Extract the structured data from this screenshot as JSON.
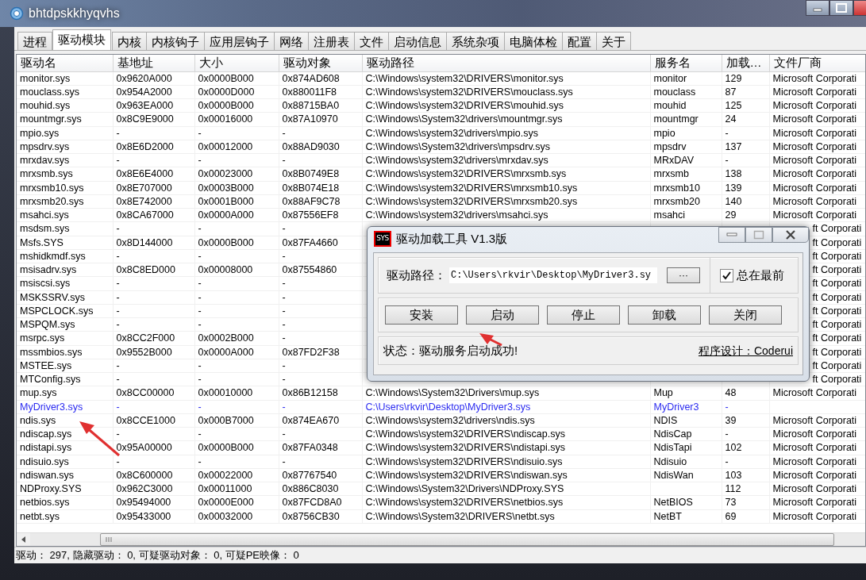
{
  "window": {
    "title": "bhtdpskkhyqvhs"
  },
  "tabs": [
    {
      "label": "进程",
      "selected": false
    },
    {
      "label": "驱动模块",
      "selected": true
    },
    {
      "label": "内核",
      "selected": false
    },
    {
      "label": "内核钩子",
      "selected": false
    },
    {
      "label": "应用层钩子",
      "selected": false
    },
    {
      "label": "网络",
      "selected": false
    },
    {
      "label": "注册表",
      "selected": false
    },
    {
      "label": "文件",
      "selected": false
    },
    {
      "label": "启动信息",
      "selected": false
    },
    {
      "label": "系统杂项",
      "selected": false
    },
    {
      "label": "电脑体检",
      "selected": false
    },
    {
      "label": "配置",
      "selected": false
    },
    {
      "label": "关于",
      "selected": false
    }
  ],
  "table": {
    "columns": [
      "驱动名",
      "基地址",
      "大小",
      "驱动对象",
      "驱动路径",
      "服务名",
      "加载…",
      "文件厂商"
    ],
    "rows": [
      {
        "name": "monitor.sys",
        "base": "0x9620A000",
        "size": "0x0000B000",
        "object": "0x874AD608",
        "path": "C:\\Windows\\system32\\DRIVERS\\monitor.sys",
        "service": "monitor",
        "load": "129",
        "vendor": "Microsoft Corporati"
      },
      {
        "name": "mouclass.sys",
        "base": "0x954A2000",
        "size": "0x0000D000",
        "object": "0x880011F8",
        "path": "C:\\Windows\\system32\\DRIVERS\\mouclass.sys",
        "service": "mouclass",
        "load": "87",
        "vendor": "Microsoft Corporati"
      },
      {
        "name": "mouhid.sys",
        "base": "0x963EA000",
        "size": "0x0000B000",
        "object": "0x88715BA0",
        "path": "C:\\Windows\\system32\\DRIVERS\\mouhid.sys",
        "service": "mouhid",
        "load": "125",
        "vendor": "Microsoft Corporati"
      },
      {
        "name": "mountmgr.sys",
        "base": "0x8C9E9000",
        "size": "0x00016000",
        "object": "0x87A10970",
        "path": "C:\\Windows\\System32\\drivers\\mountmgr.sys",
        "service": "mountmgr",
        "load": "24",
        "vendor": "Microsoft Corporati"
      },
      {
        "name": "mpio.sys",
        "base": "-",
        "size": "-",
        "object": "-",
        "path": "C:\\Windows\\system32\\drivers\\mpio.sys",
        "service": "mpio",
        "load": "-",
        "vendor": "Microsoft Corporati"
      },
      {
        "name": "mpsdrv.sys",
        "base": "0x8E6D2000",
        "size": "0x00012000",
        "object": "0x88AD9030",
        "path": "C:\\Windows\\System32\\drivers\\mpsdrv.sys",
        "service": "mpsdrv",
        "load": "137",
        "vendor": "Microsoft Corporati"
      },
      {
        "name": "mrxdav.sys",
        "base": "-",
        "size": "-",
        "object": "-",
        "path": "C:\\Windows\\system32\\drivers\\mrxdav.sys",
        "service": "MRxDAV",
        "load": "-",
        "vendor": "Microsoft Corporati"
      },
      {
        "name": "mrxsmb.sys",
        "base": "0x8E6E4000",
        "size": "0x00023000",
        "object": "0x8B0749E8",
        "path": "C:\\Windows\\system32\\DRIVERS\\mrxsmb.sys",
        "service": "mrxsmb",
        "load": "138",
        "vendor": "Microsoft Corporati"
      },
      {
        "name": "mrxsmb10.sys",
        "base": "0x8E707000",
        "size": "0x0003B000",
        "object": "0x8B074E18",
        "path": "C:\\Windows\\system32\\DRIVERS\\mrxsmb10.sys",
        "service": "mrxsmb10",
        "load": "139",
        "vendor": "Microsoft Corporati"
      },
      {
        "name": "mrxsmb20.sys",
        "base": "0x8E742000",
        "size": "0x0001B000",
        "object": "0x88AF9C78",
        "path": "C:\\Windows\\system32\\DRIVERS\\mrxsmb20.sys",
        "service": "mrxsmb20",
        "load": "140",
        "vendor": "Microsoft Corporati"
      },
      {
        "name": "msahci.sys",
        "base": "0x8CA67000",
        "size": "0x0000A000",
        "object": "0x87556EF8",
        "path": "C:\\Windows\\system32\\drivers\\msahci.sys",
        "service": "msahci",
        "load": "29",
        "vendor": "Microsoft Corporati"
      },
      {
        "name": "msdsm.sys",
        "base": "-",
        "size": "-",
        "object": "-",
        "vendor": "ft Corporati",
        "covered": true
      },
      {
        "name": "Msfs.SYS",
        "base": "0x8D144000",
        "size": "0x0000B000",
        "object": "0x87FA4660",
        "vendor": "ft Corporati",
        "covered": true
      },
      {
        "name": "mshidkmdf.sys",
        "base": "-",
        "size": "-",
        "object": "-",
        "vendor": "ft Corporati",
        "covered": true
      },
      {
        "name": "msisadrv.sys",
        "base": "0x8C8ED000",
        "size": "0x00008000",
        "object": "0x87554860",
        "vendor": "ft Corporati",
        "covered": true
      },
      {
        "name": "msiscsi.sys",
        "base": "-",
        "size": "-",
        "object": "-",
        "vendor": "ft Corporati",
        "covered": true
      },
      {
        "name": "MSKSSRV.sys",
        "base": "-",
        "size": "-",
        "object": "-",
        "vendor": "ft Corporati",
        "covered": true
      },
      {
        "name": "MSPCLOCK.sys",
        "base": "-",
        "size": "-",
        "object": "-",
        "vendor": "ft Corporati",
        "covered": true
      },
      {
        "name": "MSPQM.sys",
        "base": "-",
        "size": "-",
        "object": "-",
        "vendor": "ft Corporati",
        "covered": true
      },
      {
        "name": "msrpc.sys",
        "base": "0x8CC2F000",
        "size": "0x0002B000",
        "object": "-",
        "vendor": "ft Corporati",
        "covered": true
      },
      {
        "name": "mssmbios.sys",
        "base": "0x9552B000",
        "size": "0x0000A000",
        "object": "0x87FD2F38",
        "vendor": "ft Corporati",
        "covered": true
      },
      {
        "name": "MSTEE.sys",
        "base": "-",
        "size": "-",
        "object": "-",
        "vendor": "ft Corporati",
        "covered": true
      },
      {
        "name": "MTConfig.sys",
        "base": "-",
        "size": "-",
        "object": "-",
        "vendor": "ft Corporati",
        "covered": true
      },
      {
        "name": "mup.sys",
        "base": "0x8CC00000",
        "size": "0x00010000",
        "object": "0x86B12158",
        "path": "C:\\Windows\\System32\\Drivers\\mup.sys",
        "service": "Mup",
        "load": "48",
        "vendor": "Microsoft Corporati"
      },
      {
        "name": "MyDriver3.sys",
        "base": "-",
        "size": "-",
        "object": "-",
        "path": "C:\\Users\\rkvir\\Desktop\\MyDriver3.sys",
        "service": "MyDriver3",
        "load": "-",
        "color": "#2b2bf0"
      },
      {
        "name": "ndis.sys",
        "base": "0x8CCE1000",
        "size": "0x000B7000",
        "object": "0x874EA670",
        "path": "C:\\Windows\\system32\\drivers\\ndis.sys",
        "service": "NDIS",
        "load": "39",
        "vendor": "Microsoft Corporati"
      },
      {
        "name": "ndiscap.sys",
        "base": "-",
        "size": "-",
        "object": "-",
        "path": "C:\\Windows\\system32\\DRIVERS\\ndiscap.sys",
        "service": "NdisCap",
        "load": "-",
        "vendor": "Microsoft Corporati"
      },
      {
        "name": "ndistapi.sys",
        "base": "0x95A00000",
        "size": "0x0000B000",
        "object": "0x87FA0348",
        "path": "C:\\Windows\\system32\\DRIVERS\\ndistapi.sys",
        "service": "NdisTapi",
        "load": "102",
        "vendor": "Microsoft Corporati"
      },
      {
        "name": "ndisuio.sys",
        "base": "-",
        "size": "-",
        "object": "-",
        "path": "C:\\Windows\\system32\\DRIVERS\\ndisuio.sys",
        "service": "Ndisuio",
        "load": "-",
        "vendor": "Microsoft Corporati"
      },
      {
        "name": "ndiswan.sys",
        "base": "0x8C600000",
        "size": "0x00022000",
        "object": "0x87767540",
        "path": "C:\\Windows\\system32\\DRIVERS\\ndiswan.sys",
        "service": "NdisWan",
        "load": "103",
        "vendor": "Microsoft Corporati"
      },
      {
        "name": "NDProxy.SYS",
        "base": "0x962C3000",
        "size": "0x00011000",
        "object": "0x886C8030",
        "path": "C:\\Windows\\System32\\Drivers\\NDProxy.SYS",
        "load": "112",
        "vendor": "Microsoft Corporati"
      },
      {
        "name": "netbios.sys",
        "base": "0x95494000",
        "size": "0x0000E000",
        "object": "0x87FCD8A0",
        "path": "C:\\Windows\\system32\\DRIVERS\\netbios.sys",
        "service": "NetBIOS",
        "load": "73",
        "vendor": "Microsoft Corporati"
      },
      {
        "name": "netbt.sys",
        "base": "0x95433000",
        "size": "0x00032000",
        "object": "0x8756CB30",
        "path": "C:\\Windows\\System32\\DRIVERS\\netbt.sys",
        "service": "NetBT",
        "load": "69",
        "vendor": "Microsoft Corporati"
      }
    ]
  },
  "status_bar": "驱动： 297, 隐藏驱动： 0, 可疑驱动对象： 0, 可疑PE映像： 0",
  "dialog": {
    "icon_text": "SYS",
    "title": "驱动加载工具 V1.3版",
    "path_label": "驱动路径：",
    "path_value": "C:\\Users\\rkvir\\Desktop\\MyDriver3.sy",
    "browse_button": "···",
    "always_on_top": {
      "label": "总在最前",
      "checked": true
    },
    "buttons": [
      "安装",
      "启动",
      "停止",
      "卸载",
      "关闭"
    ],
    "status": "状态：驱动服务启动成功!",
    "credit_link": "程序设计：Coderui"
  }
}
